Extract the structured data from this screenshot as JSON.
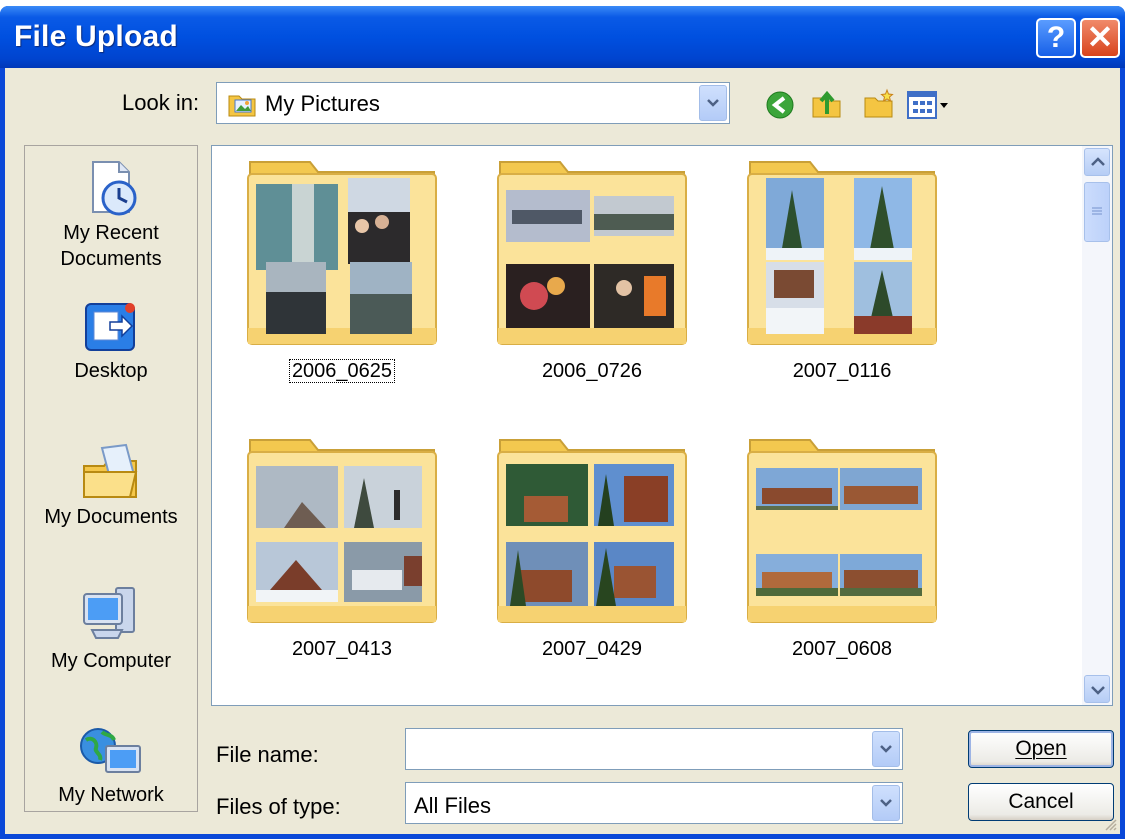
{
  "window": {
    "title": "File Upload"
  },
  "titlebar_buttons": {
    "help": "?",
    "close": "✕"
  },
  "look_in": {
    "label": "Look in:",
    "value": "My Pictures"
  },
  "toolbar": [
    "back-icon",
    "up-folder-icon",
    "new-folder-icon",
    "view-menu-icon"
  ],
  "places": [
    {
      "label_line1": "My Recent",
      "label_line2": "Documents",
      "icon": "recent-documents-icon"
    },
    {
      "label_line1": "Desktop",
      "label_line2": "",
      "icon": "desktop-icon"
    },
    {
      "label_line1": "My Documents",
      "label_line2": "",
      "icon": "my-documents-icon"
    },
    {
      "label_line1": "My Computer",
      "label_line2": "",
      "icon": "my-computer-icon"
    },
    {
      "label_line1": "My Network",
      "label_line2": "",
      "icon": "my-network-icon"
    }
  ],
  "folders": [
    {
      "name": "2006_0625",
      "selected": true
    },
    {
      "name": "2006_0726",
      "selected": false
    },
    {
      "name": "2007_0116",
      "selected": false
    },
    {
      "name": "2007_0413",
      "selected": false
    },
    {
      "name": "2007_0429",
      "selected": false
    },
    {
      "name": "2007_0608",
      "selected": false
    }
  ],
  "file_name": {
    "label": "File name:",
    "value": ""
  },
  "file_type": {
    "label": "Files of type:",
    "value": "All Files"
  },
  "buttons": {
    "open": "Open",
    "cancel": "Cancel"
  },
  "colors": {
    "title_bar": "#0050e0",
    "dialog_face": "#ece9d8",
    "folder": "#f8d775"
  }
}
